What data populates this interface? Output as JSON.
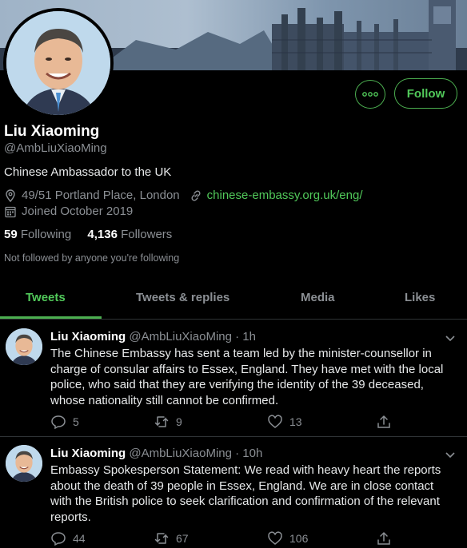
{
  "profile": {
    "name": "Liu Xiaoming",
    "handle": "@AmbLiuXiaoMing",
    "bio": "Chinese Ambassador to the UK",
    "location": "49/51 Portland Place, London",
    "website": "chinese-embassy.org.uk/eng/",
    "joined": "Joined October 2019",
    "following_count": "59",
    "following_label": "Following",
    "followers_count": "4,136",
    "followers_label": "Followers",
    "not_followed": "Not followed by anyone you're following"
  },
  "actions": {
    "follow_label": "Follow"
  },
  "tabs": [
    {
      "label": "Tweets",
      "active": true
    },
    {
      "label": "Tweets & replies",
      "active": false
    },
    {
      "label": "Media",
      "active": false
    },
    {
      "label": "Likes",
      "active": false
    }
  ],
  "tweets": [
    {
      "name": "Liu Xiaoming",
      "handle": "@AmbLiuXiaoMing",
      "time": "· 1h",
      "text": "The Chinese Embassy has sent a team led by the minister-counsellor in charge of consular affairs to Essex, England. They have met with the local police, who said that they are verifying the identity of the 39 deceased, whose nationality still cannot be confirmed.",
      "replies": "5",
      "retweets": "9",
      "likes": "13"
    },
    {
      "name": "Liu Xiaoming",
      "handle": "@AmbLiuXiaoMing",
      "time": "· 10h",
      "text": "Embassy Spokesperson Statement: We read with heavy heart the reports about the death of 39 people in Essex, England. We are in close contact with the British police to seek clarification and confirmation of the relevant reports.",
      "replies": "44",
      "retweets": "67",
      "likes": "106"
    }
  ],
  "colors": {
    "accent": "#51c95a",
    "background": "#000000",
    "muted": "#8b8f94",
    "divider": "#2f3336"
  }
}
